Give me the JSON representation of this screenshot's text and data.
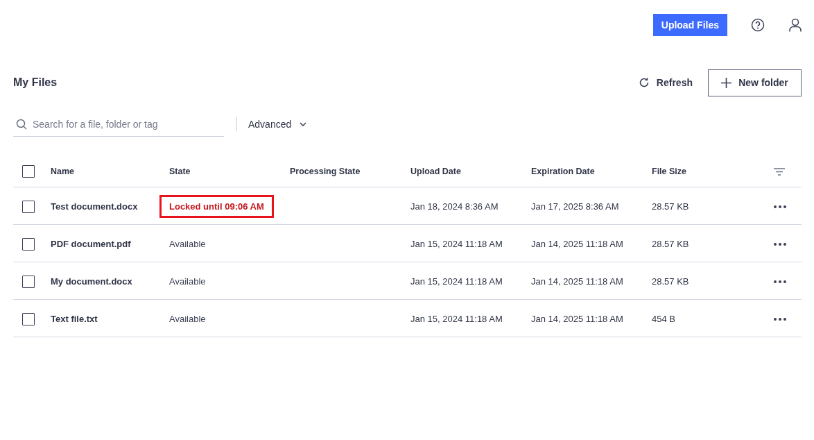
{
  "header": {
    "upload_button": "Upload Files"
  },
  "page": {
    "title": "My Files",
    "refresh_button": "Refresh",
    "new_folder_button": "New folder"
  },
  "search": {
    "placeholder": "Search for a file, folder or tag"
  },
  "advanced_button": "Advanced",
  "table": {
    "select_all_checked": false,
    "columns": [
      "Name",
      "State",
      "Processing State",
      "Upload Date",
      "Expiration Date",
      "File Size"
    ],
    "rows": [
      {
        "checked": false,
        "name": "Test document.docx",
        "locked": true,
        "state": "Locked until 09:06 AM",
        "highlighted": true,
        "upload_date": "Jan 18, 2024 8:36 AM",
        "expiration_date": "Jan 17, 2025 8:36 AM",
        "file_size": "28.57 KB"
      },
      {
        "checked": false,
        "name": "PDF document.pdf",
        "locked": false,
        "state": "Available",
        "highlighted": false,
        "upload_date": "Jan 15, 2024 11:18 AM",
        "expiration_date": "Jan 14, 2025 11:18 AM",
        "file_size": "28.57 KB"
      },
      {
        "checked": false,
        "name": "My document.docx",
        "locked": false,
        "state": "Available",
        "highlighted": false,
        "upload_date": "Jan 15, 2024 11:18 AM",
        "expiration_date": "Jan 14, 2025 11:18 AM",
        "file_size": "28.57 KB"
      },
      {
        "checked": false,
        "name": "Text file.txt",
        "locked": false,
        "state": "Available",
        "highlighted": false,
        "upload_date": "Jan 15, 2024 11:18 AM",
        "expiration_date": "Jan 14, 2025 11:18 AM",
        "file_size": "454 B"
      }
    ]
  }
}
